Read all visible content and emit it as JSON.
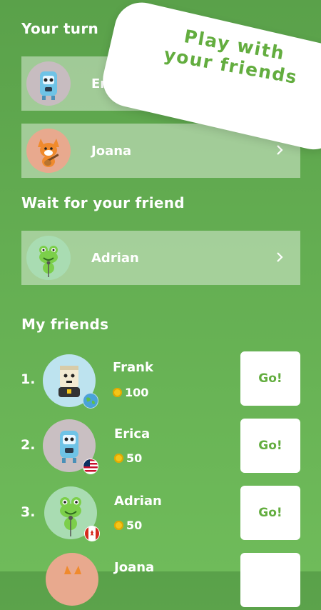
{
  "banner": {
    "line1": "Play with",
    "line2": "your friends"
  },
  "sections": {
    "your_turn": "Your turn",
    "wait": "Wait for your friend",
    "my_friends": "My friends"
  },
  "your_turn_games": [
    {
      "name": "Erica",
      "avatar": "blue-robot-avatar"
    },
    {
      "name": "Joana",
      "avatar": "fox-guitar-avatar"
    }
  ],
  "waiting_games": [
    {
      "name": "Adrian",
      "avatar": "frog-singer-avatar"
    }
  ],
  "friends": [
    {
      "rank": "1.",
      "name": "Frank",
      "coins": "100",
      "avatar": "box-robot-avatar",
      "flag": "globe-icon",
      "go": "Go!"
    },
    {
      "rank": "2.",
      "name": "Erica",
      "coins": "50",
      "avatar": "blue-robot-avatar",
      "flag": "us-flag-icon",
      "go": "Go!"
    },
    {
      "rank": "3.",
      "name": "Adrian",
      "coins": "50",
      "avatar": "frog-singer-avatar",
      "flag": "canada-flag-icon",
      "go": "Go!"
    },
    {
      "rank": "",
      "name": "Joana",
      "coins": "",
      "avatar": "fox-guitar-avatar",
      "flag": "",
      "go": ""
    }
  ],
  "colors": {
    "accent": "#63ad3f",
    "bg_top": "#5aa14a",
    "bg_bottom": "#6fbb5a"
  }
}
